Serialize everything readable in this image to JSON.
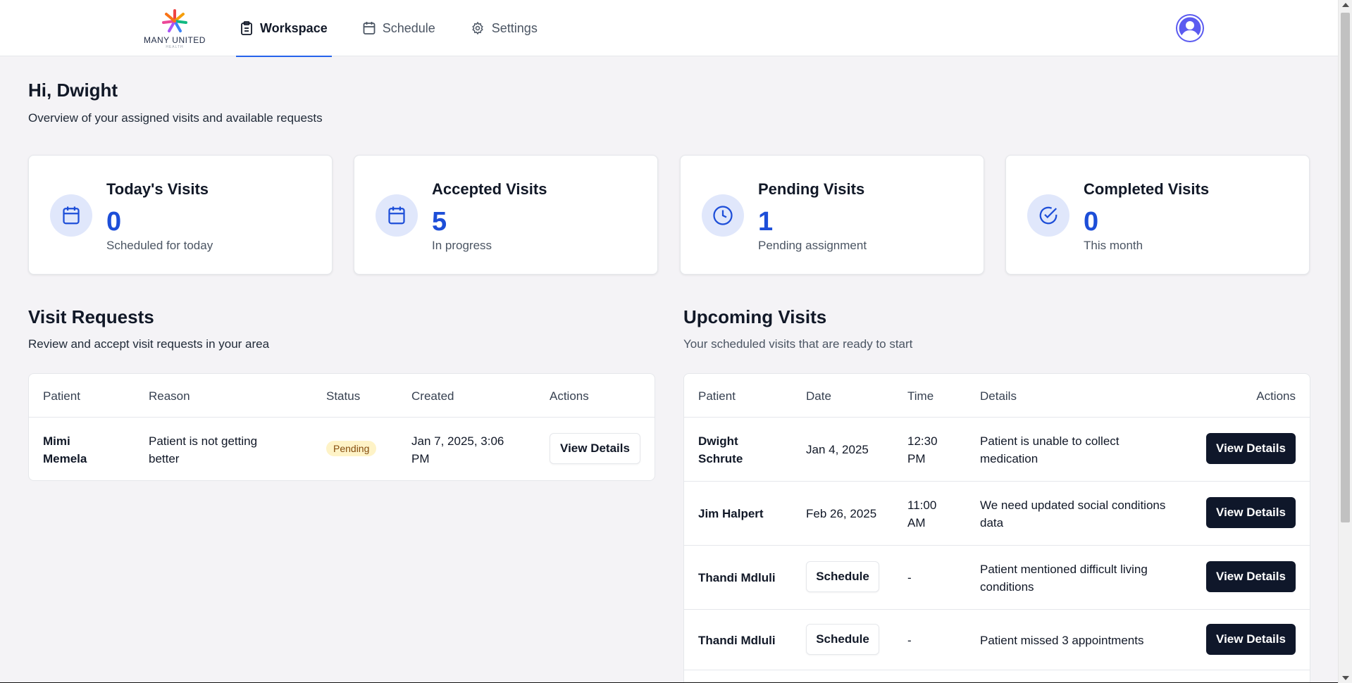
{
  "brand": {
    "name": "MANY UNITED",
    "tagline": "HEALTH",
    "colors": [
      "#f59e0b",
      "#ef4444",
      "#10b981",
      "#3b82f6",
      "#a855f7",
      "#ec4899"
    ]
  },
  "nav": {
    "tabs": [
      {
        "label": "Workspace",
        "icon": "clipboard-icon",
        "active": true
      },
      {
        "label": "Schedule",
        "icon": "calendar-icon",
        "active": false
      },
      {
        "label": "Settings",
        "icon": "gear-icon",
        "active": false
      }
    ],
    "avatar_icon": "user-avatar-icon"
  },
  "header": {
    "greeting": "Hi, Dwight",
    "subtitle": "Overview of your assigned visits and available requests"
  },
  "stats": [
    {
      "title": "Today's Visits",
      "value": "0",
      "sub": "Scheduled for today",
      "icon": "calendar-icon"
    },
    {
      "title": "Accepted Visits",
      "value": "5",
      "sub": "In progress",
      "icon": "calendar-icon"
    },
    {
      "title": "Pending Visits",
      "value": "1",
      "sub": "Pending assignment",
      "icon": "clock-icon"
    },
    {
      "title": "Completed Visits",
      "value": "0",
      "sub": "This month",
      "icon": "check-circle-icon"
    }
  ],
  "visit_requests": {
    "title": "Visit Requests",
    "subtitle": "Review and accept visit requests in your area",
    "columns": [
      "Patient",
      "Reason",
      "Status",
      "Created",
      "Actions"
    ],
    "rows": [
      {
        "patient_line1": "Mimi",
        "patient_line2": "Memela",
        "reason_line1": "Patient is not getting",
        "reason_line2": "better",
        "status": "Pending",
        "created_line1": "Jan 7, 2025, 3:06",
        "created_line2": "PM",
        "action": "View Details"
      }
    ]
  },
  "upcoming_visits": {
    "title": "Upcoming Visits",
    "subtitle": "Your scheduled visits that are ready to start",
    "columns": [
      "Patient",
      "Date",
      "Time",
      "Details",
      "Actions"
    ],
    "rows": [
      {
        "patient_line1": "Dwight",
        "patient_line2": "Schrute",
        "date": "Jan 4, 2025",
        "time_line1": "12:30",
        "time_line2": "PM",
        "details_line1": "Patient is unable to collect",
        "details_line2": "medication",
        "action": "View Details"
      },
      {
        "patient_line1": "Jim Halpert",
        "patient_line2": "",
        "date": "Feb 26, 2025",
        "time_line1": "11:00",
        "time_line2": "AM",
        "details_line1": "We need updated social conditions",
        "details_line2": "data",
        "action": "View Details"
      },
      {
        "patient_line1": "Thandi Mdluli",
        "patient_line2": "",
        "date_button": "Schedule",
        "time_line1": "-",
        "time_line2": "",
        "details_line1": "Patient mentioned difficult living",
        "details_line2": "conditions",
        "action": "View Details"
      },
      {
        "patient_line1": "Thandi Mdluli",
        "patient_line2": "",
        "date_button": "Schedule",
        "time_line1": "-",
        "time_line2": "",
        "details_line1": "Patient missed 3 appointments",
        "details_line2": "",
        "action": "View Details"
      }
    ]
  }
}
